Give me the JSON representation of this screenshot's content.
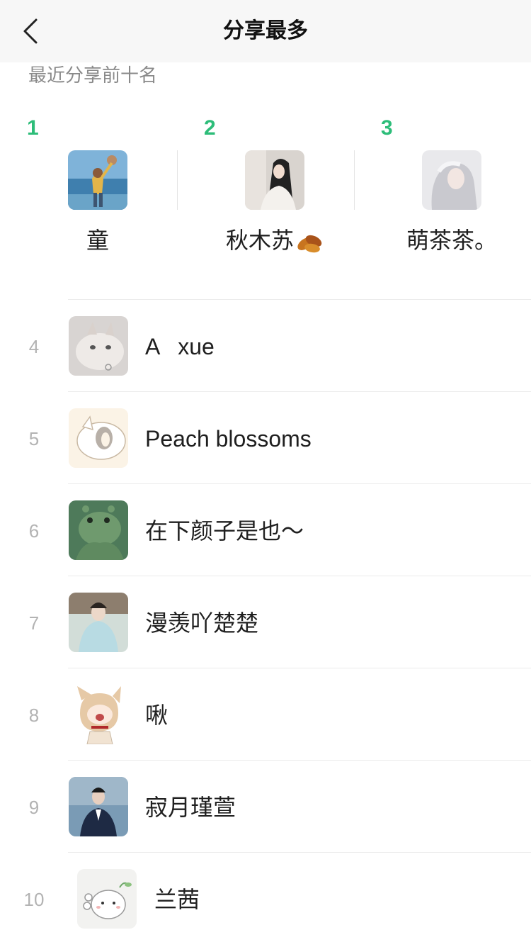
{
  "header": {
    "title": "分享最多",
    "back_icon": "chevron-left-icon"
  },
  "subtitle": "最近分享前十名",
  "colors": {
    "accent": "#2dbd79",
    "rank_gray": "#b3b3b3",
    "divider": "#ececec"
  },
  "top3": [
    {
      "rank": "1",
      "name": "童"
    },
    {
      "rank": "2",
      "name": "秋木苏"
    },
    {
      "rank": "3",
      "name": "萌茶茶。"
    }
  ],
  "list": [
    {
      "rank": "4",
      "name": "A   xue"
    },
    {
      "rank": "5",
      "name": "Peach blossoms"
    },
    {
      "rank": "6",
      "name": "在下颜子是也～"
    },
    {
      "rank": "7",
      "name": "漫羡吖楚楚"
    },
    {
      "rank": "8",
      "name": "啾"
    },
    {
      "rank": "9",
      "name": "寂月瑾萱"
    },
    {
      "rank": "10",
      "name": "兰茜"
    }
  ]
}
